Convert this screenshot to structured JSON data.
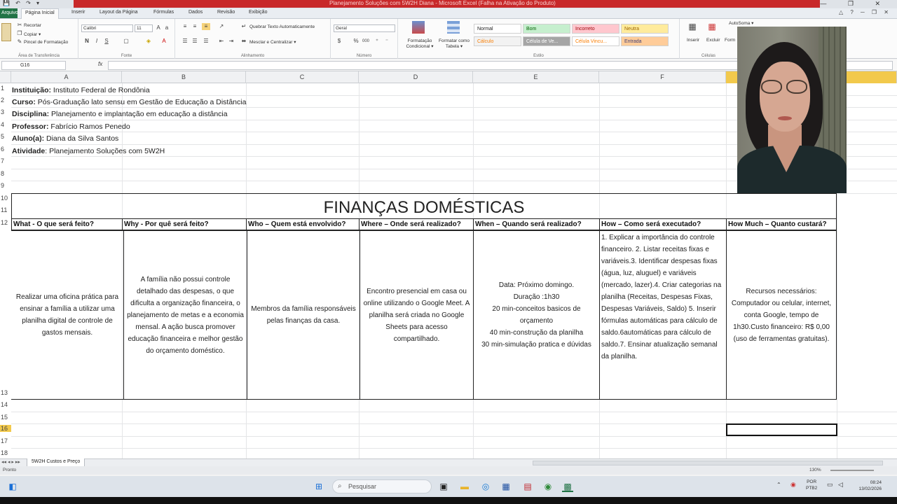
{
  "window": {
    "title": "Planejamento Soluções com 5W2H Diana - Microsoft Excel (Falha na Ativação do Produto)",
    "quick_access_icons": "💾 ↶ ↷ ▾"
  },
  "ribbon_tabs": [
    "Arquivo",
    "Página Inicial",
    "Inserir",
    "Layout da Página",
    "Fórmulas",
    "Dados",
    "Revisão",
    "Exibição"
  ],
  "ribbon": {
    "clipboard": {
      "cut": "Recortar",
      "copy": "Copiar ▾",
      "format_painter": "Pincel de Formatação",
      "label": "Área de Transferência"
    },
    "font": {
      "name": "Calibri",
      "size": "11",
      "label": "Fonte",
      "bold": "N",
      "italic": "I",
      "underline": "S"
    },
    "alignment": {
      "wrap": "Quebrar Texto Automaticamente",
      "merge": "Mesclar e Centralizar ▾",
      "label": "Alinhamento"
    },
    "number": {
      "format": "Geral",
      "label": "Número",
      "percent": "%",
      "thousands": "000"
    },
    "styles": {
      "conditional": "Formatação Condicional ▾",
      "as_table": "Formatar como Tabela ▾",
      "label": "Estilo",
      "cells": [
        {
          "text": "Normal",
          "bg": "#ffffff",
          "color": "#222222"
        },
        {
          "text": "Bom",
          "bg": "#c6efce",
          "color": "#006100"
        },
        {
          "text": "Incorreto",
          "bg": "#ffc7ce",
          "color": "#9c0006"
        },
        {
          "text": "Neutra",
          "bg": "#ffeb9c",
          "color": "#9c6500"
        },
        {
          "text": "Cálculo",
          "bg": "#f2f2f2",
          "color": "#fa7d00"
        },
        {
          "text": "Célula de Ve...",
          "bg": "#a5a5a5",
          "color": "#ffffff"
        },
        {
          "text": "Célula Vincu...",
          "bg": "#ffffff",
          "color": "#fa7d00"
        },
        {
          "text": "Entrada",
          "bg": "#ffcc99",
          "color": "#3f3f76"
        }
      ]
    },
    "cells_group": {
      "insert": "Inserir",
      "delete": "Excluir",
      "format": "Form",
      "label": "Células"
    },
    "autosum": "AutoSoma ▾"
  },
  "formula_bar": {
    "name_box": "G16",
    "fx": "fx",
    "value": ""
  },
  "columns": [
    "A",
    "B",
    "C",
    "D",
    "E",
    "F",
    "G"
  ],
  "rows": [
    "1",
    "2",
    "3",
    "4",
    "5",
    "6",
    "7",
    "8",
    "9",
    "10",
    "11",
    "12",
    "13",
    "14",
    "15",
    "16",
    "17",
    "18"
  ],
  "info": [
    {
      "label": "Instituição:",
      "value": " Instituto Federal de Rondônia"
    },
    {
      "label": "Curso:",
      "value": " Pós-Graduação lato sensu em Gestão de Educação a Distância"
    },
    {
      "label": "Disciplina:",
      "value": " Planejamento e implantação em educação a distância"
    },
    {
      "label": "Professor:",
      "value": " Fabrício Ramos Penedo"
    },
    {
      "label": "Aluno(a):",
      "value": " Diana da Silva Santos"
    },
    {
      "label": "Atividade",
      "value": ": Planejamento Soluções com 5W2H"
    }
  ],
  "table": {
    "title": "FINANÇAS DOMÉSTICAS",
    "headers": [
      "What - O que será feito?",
      "Why - Por quê será feito?",
      "Who – Quem está envolvido?",
      "Where – Onde será realizado?",
      "When – Quando será realizado?",
      "How – Como será executado?",
      "How Much – Quanto custará?"
    ],
    "cells": [
      "Realizar uma oficina prática para ensinar a família a utilizar uma planilha digital de controle de gastos mensais.",
      "A família não possui controle detalhado das despesas, o que dificulta a organização financeira, o planejamento de metas e a economia mensal. A ação busca promover educação financeira e melhor gestão do orçamento doméstico.",
      "Membros da família responsáveis pelas finanças da casa.",
      "Encontro presencial em casa ou online utilizando o Google Meet. A planilha será criada no Google Sheets para acesso compartilhado.",
      "Data: Próximo domingo.\nDuração :1h30\n20 min-conceitos basicos de orçamento\n40 min-construção da planilha\n30 min-simulação pratica  e dúvidas",
      "1. Explicar a importância do controle financeiro. 2. Listar receitas fixas e variáveis.3. Identificar despesas fixas (água, luz, aluguel) e variáveis (mercado, lazer).4. Criar categorias na planilha (Receitas, Despesas Fixas, Despesas Variáveis, Saldo) 5. Inserir fórmulas automáticas para cálculo de saldo.6automáticas para cálculo de saldo.7. Ensinar atualização semanal da planilha.",
      "Recursos necessários: Computador ou celular, internet, conta Google, tempo de 1h30.Custo financeiro: R$ 0,00 (uso de ferramentas gratuitas)."
    ]
  },
  "sheet_tab": "5W2H Custos e Preço",
  "status": {
    "ready": "Pronto",
    "zoom": "130%"
  },
  "taskbar": {
    "search_placeholder": "Pesquisar",
    "language": "POR",
    "layout": "PTB2",
    "time": "08:24",
    "date": "13/02/2026"
  }
}
